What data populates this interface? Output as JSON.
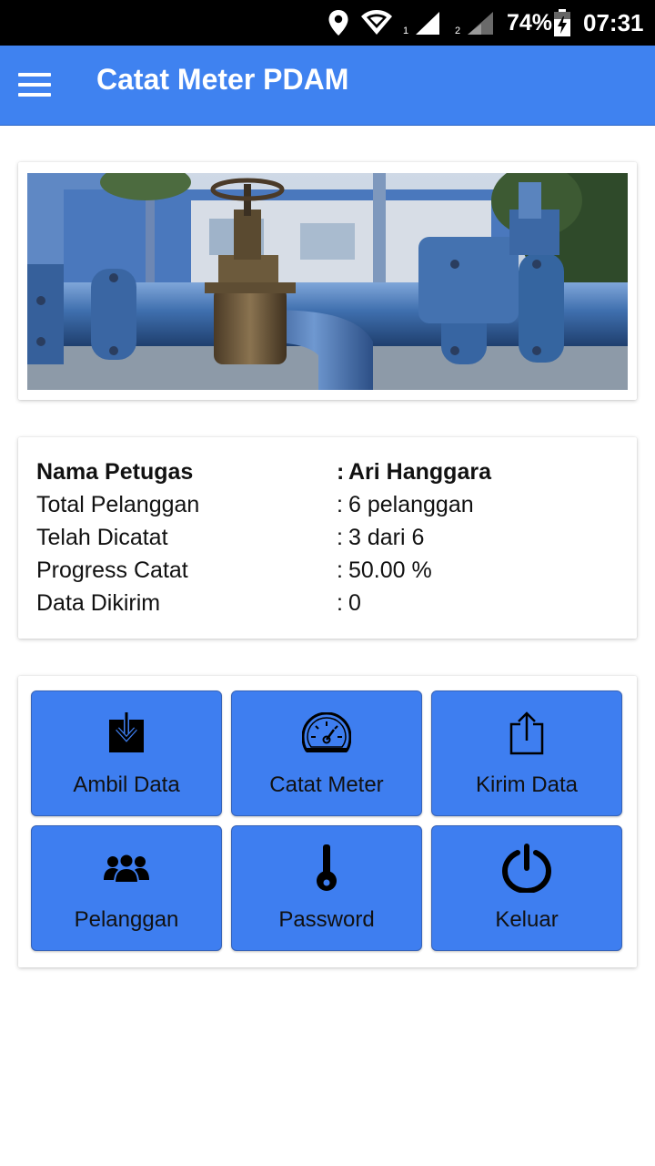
{
  "status_bar": {
    "sim1": "1",
    "sim2": "2",
    "battery": "74%",
    "time": "07:31",
    "icons": [
      "location-icon",
      "wifi-icon",
      "signal-icon",
      "battery-charging-icon"
    ]
  },
  "app_bar": {
    "title": "Catat Meter PDAM",
    "menu_icon": "hamburger-icon",
    "color": "#3f82f0"
  },
  "info": {
    "rows": [
      {
        "label": "Nama Petugas",
        "sep": ":",
        "value": "Ari Hanggara"
      },
      {
        "label": "Total Pelanggan",
        "sep": ":",
        "value": "6 pelanggan"
      },
      {
        "label": "Telah Dicatat",
        "sep": ":",
        "value": "3 dari 6"
      },
      {
        "label": "Progress Catat",
        "sep": ":",
        "value": "50.00 %"
      },
      {
        "label": "Data Dikirim",
        "sep": ":",
        "value": "0"
      }
    ]
  },
  "menu": {
    "tile_color": "#3e7ef0",
    "tiles": [
      {
        "label": "Ambil Data",
        "icon": "download-icon"
      },
      {
        "label": "Catat Meter",
        "icon": "speedometer-icon"
      },
      {
        "label": "Kirim Data",
        "icon": "upload-icon"
      },
      {
        "label": "Pelanggan",
        "icon": "users-icon"
      },
      {
        "label": "Password",
        "icon": "key-icon"
      },
      {
        "label": "Keluar",
        "icon": "power-icon"
      }
    ]
  }
}
